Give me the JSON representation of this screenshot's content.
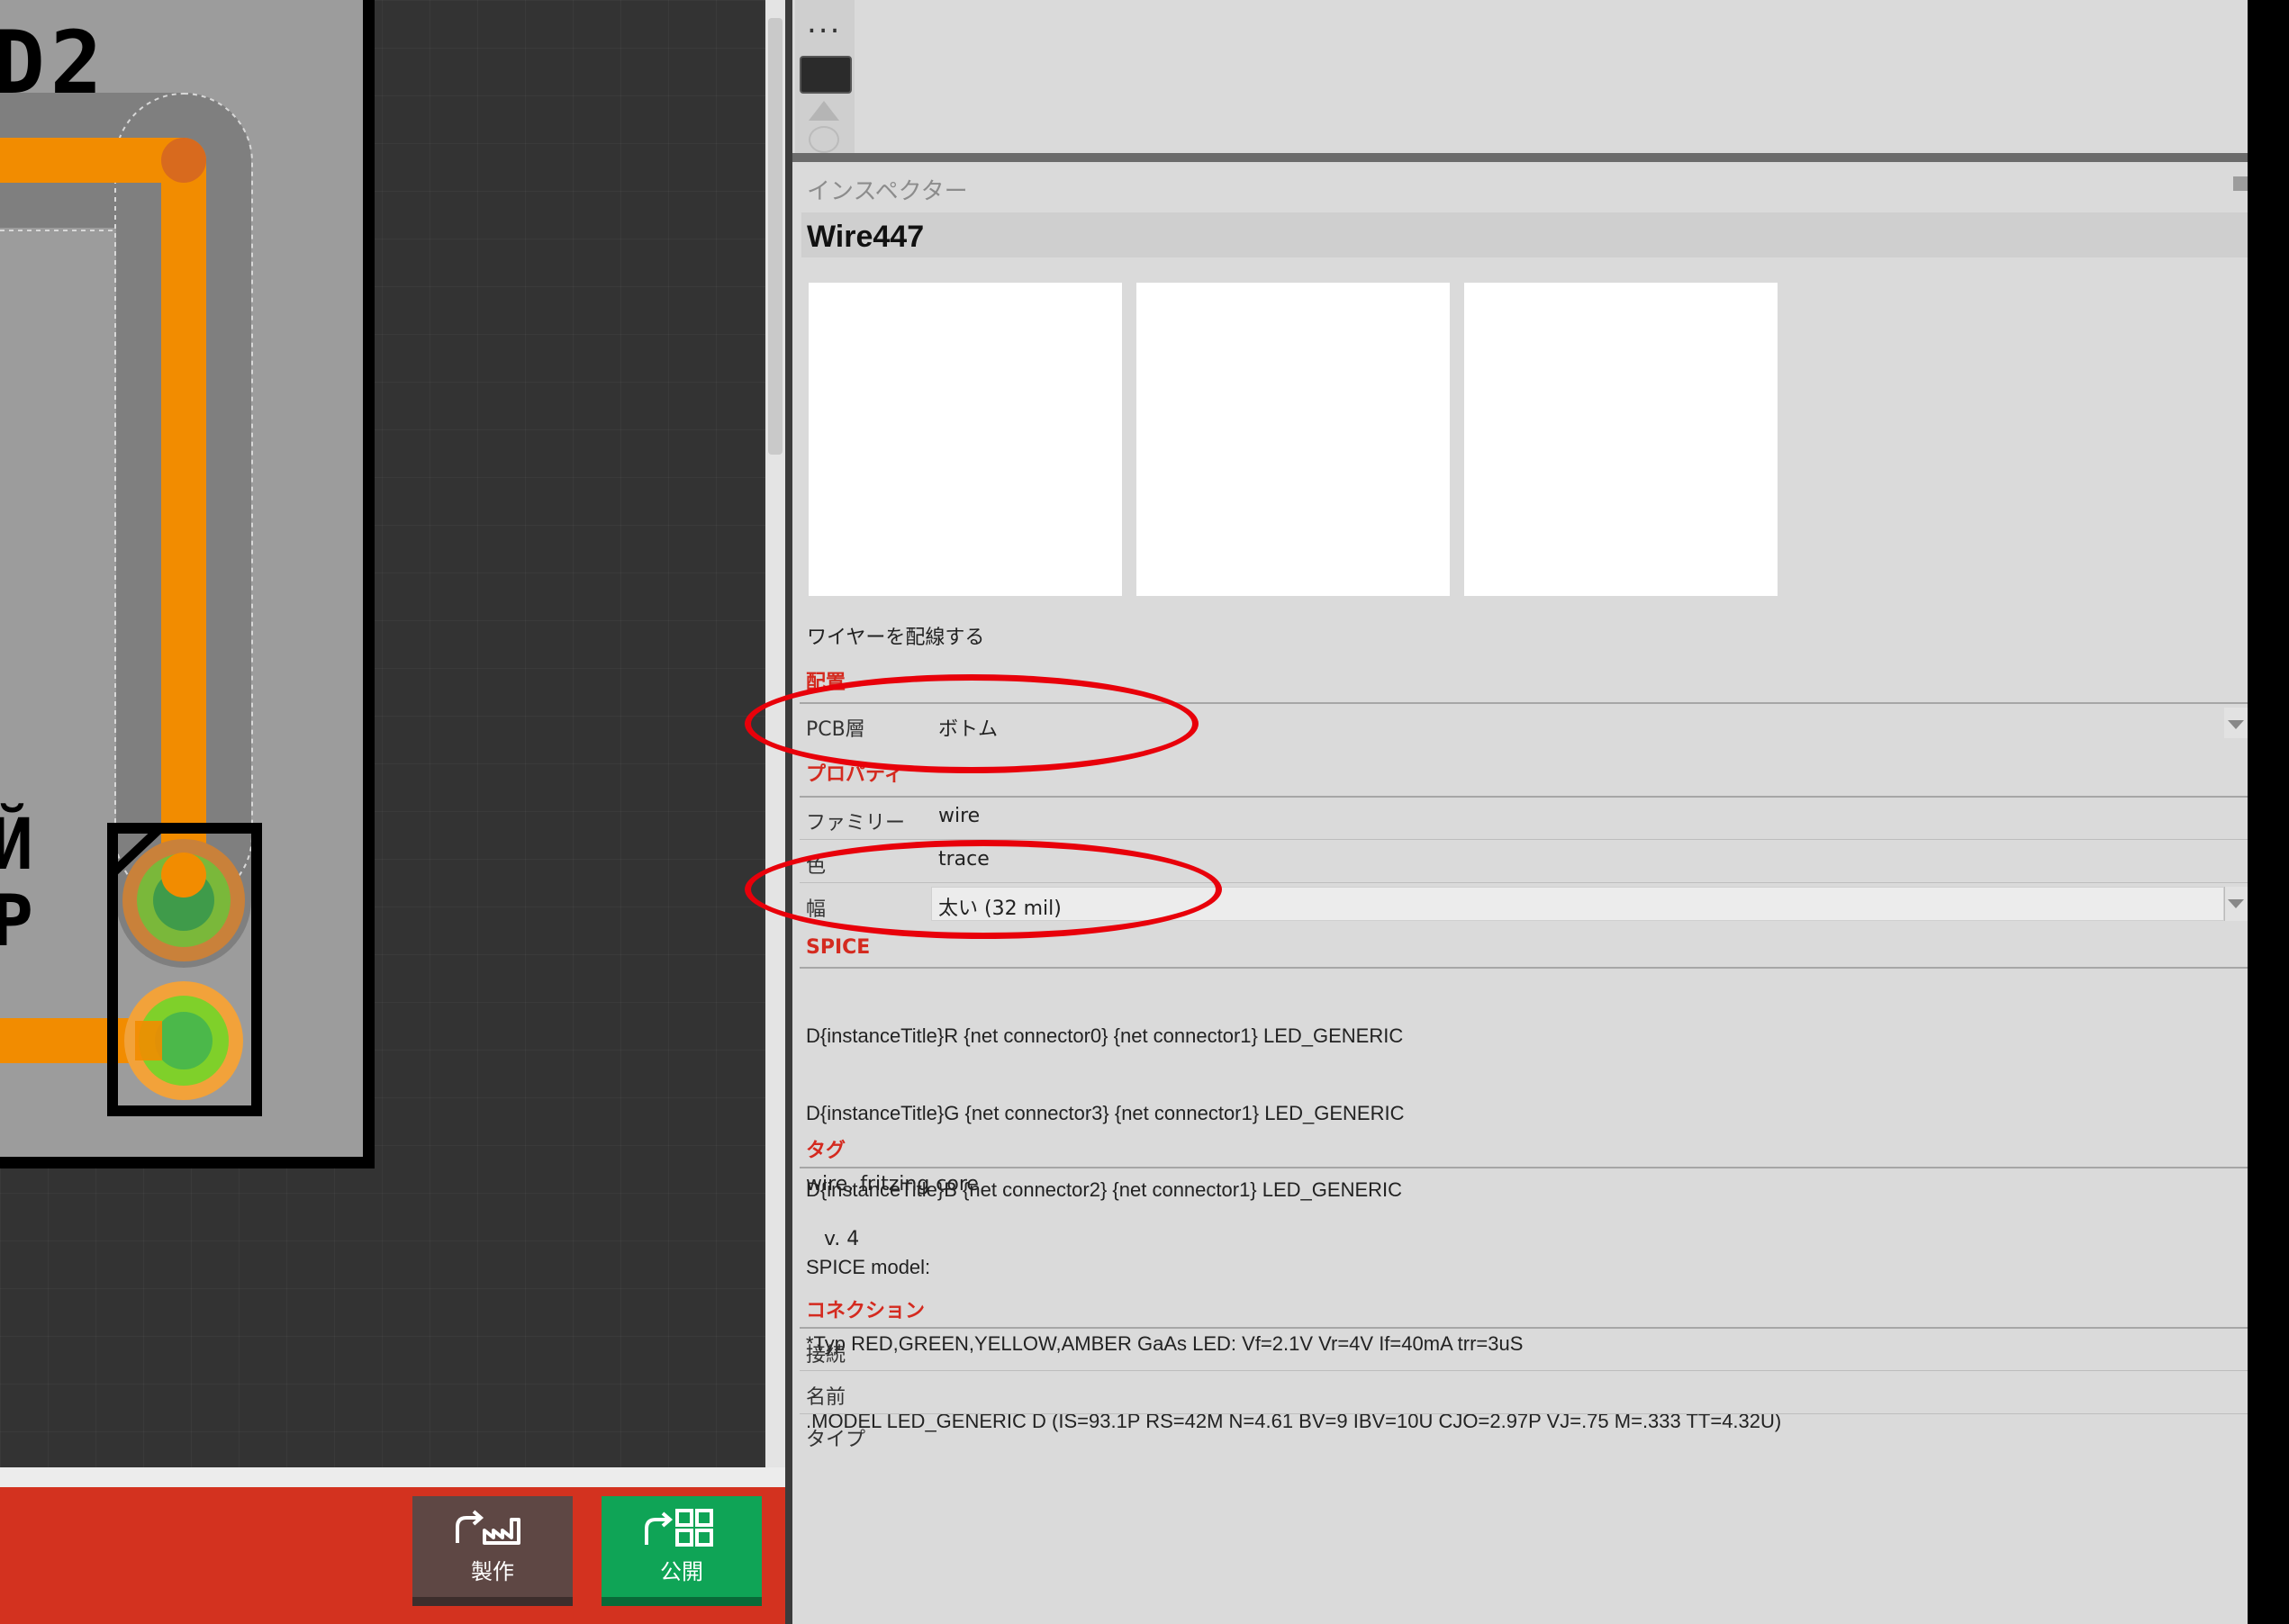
{
  "canvas": {
    "silk_label": "D2",
    "silk_fragment_1": "Й",
    "silk_fragment_2": "P"
  },
  "toolbar": {
    "fabricate_label": "製作",
    "share_label": "公開"
  },
  "parts_bin": {
    "more_glyph": "..."
  },
  "inspector": {
    "title": "インスペクター",
    "part_name": "Wire447",
    "description": "ワイヤーを配線する",
    "placement": {
      "heading": "配置",
      "pcb_layer_label": "PCB層",
      "pcb_layer_value": "ボトム"
    },
    "properties": {
      "heading": "プロパティ",
      "family_label": "ファミリー",
      "family_value": "wire",
      "color_label": "色",
      "color_value": "trace",
      "width_label": "幅",
      "width_value": "太い (32 mil)"
    },
    "spice": {
      "heading": "SPICE",
      "lines": [
        "D{instanceTitle}R {net connector0} {net connector1} LED_GENERIC",
        "D{instanceTitle}G {net connector3} {net connector1} LED_GENERIC",
        "D{instanceTitle}B {net connector2} {net connector1} LED_GENERIC",
        "SPICE model:",
        "*Typ RED,GREEN,YELLOW,AMBER GaAs LED: Vf=2.1V Vr=4V If=40mA trr=3uS",
        ".MODEL LED_GENERIC D (IS=93.1P RS=42M N=4.61 BV=9 IBV=10U CJO=2.97P VJ=.75 M=.333 TT=4.32U)"
      ]
    },
    "tags": {
      "heading": "タグ",
      "value": "wire, fritzing core"
    },
    "version": "v. 4",
    "connections": {
      "heading": "コネクション",
      "connected_label": "接続",
      "name_label": "名前",
      "type_label": "タイプ"
    }
  },
  "colors": {
    "trace": "#f28c00",
    "toolbar_red": "#d3321f",
    "share_green": "#0fa456",
    "section_heading": "#d42a1f",
    "annotation": "#e8000a"
  }
}
